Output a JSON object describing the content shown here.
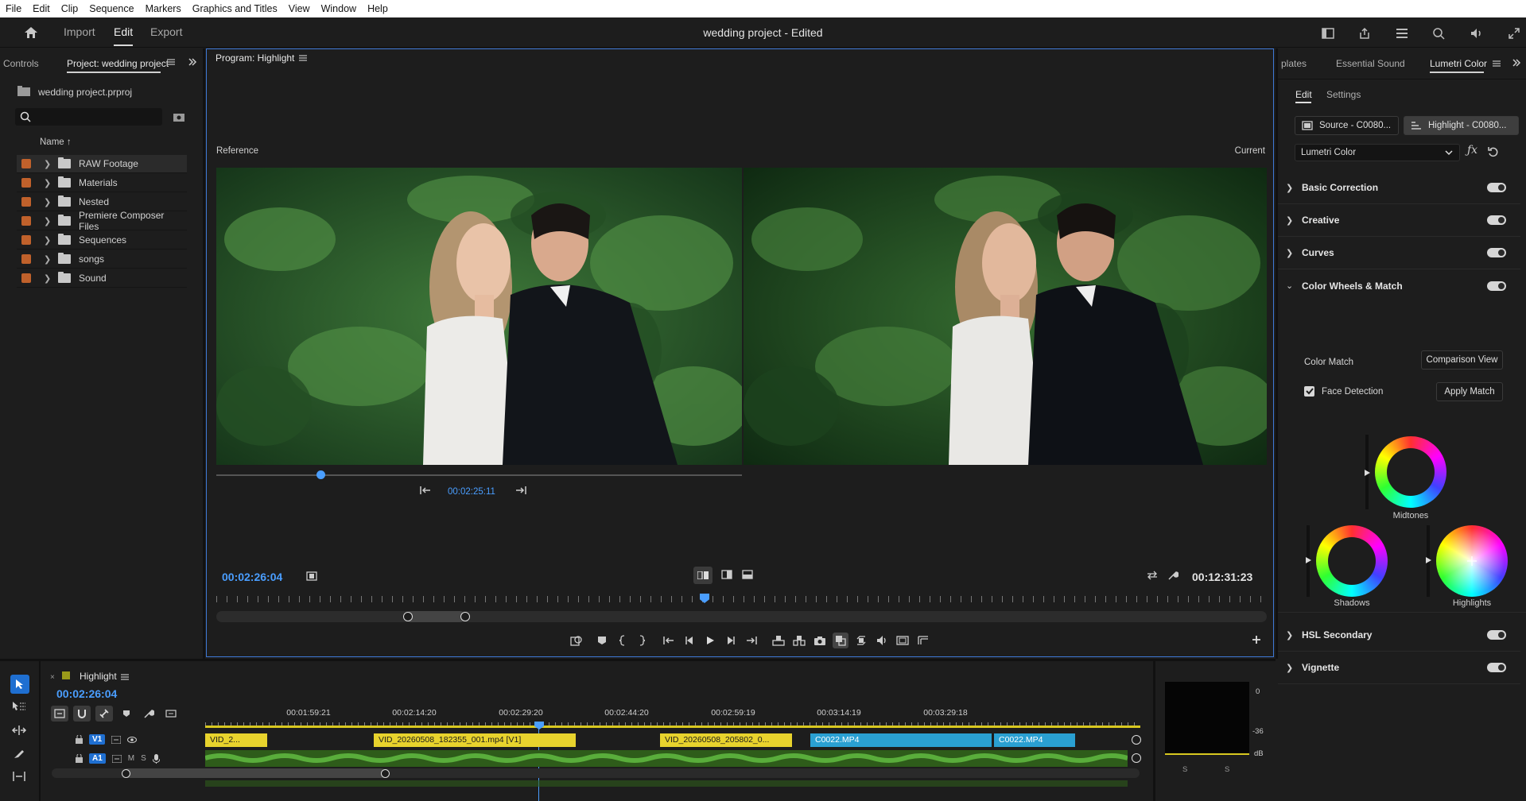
{
  "menu": [
    "File",
    "Edit",
    "Clip",
    "Sequence",
    "Markers",
    "Graphics and Titles",
    "View",
    "Window",
    "Help"
  ],
  "workspaces": {
    "home_icon": "home-icon",
    "import": "Import",
    "edit": "Edit",
    "export": "Export"
  },
  "document_title": "wedding project - Edited",
  "left_panel": {
    "tab_controls": "Controls",
    "tab_project": "Project: wedding project",
    "project_file": "wedding project.prproj",
    "search_placeholder": "",
    "column_name": "Name",
    "folders": [
      "RAW Footage",
      "Materials",
      "Nested",
      "Premiere Composer Files",
      "Sequences",
      "songs",
      "Sound"
    ]
  },
  "program": {
    "title": "Program: Highlight",
    "reference_label": "Reference",
    "current_label": "Current",
    "ref_timecode": "00:02:25:11",
    "playhead_timecode": "00:02:26:04",
    "duration_timecode": "00:12:31:23"
  },
  "lumetri": {
    "tab_templates": "plates",
    "tab_sound": "Essential Sound",
    "tab_lumetri": "Lumetri Color",
    "sub_edit": "Edit",
    "sub_settings": "Settings",
    "source_clip": "Source - C0080...",
    "highlight_clip": "Highlight - C0080...",
    "effect": "Lumetri Color",
    "sections": [
      "Basic Correction",
      "Creative",
      "Curves",
      "Color Wheels & Match"
    ],
    "color_match": "Color Match",
    "comparison_view": "Comparison View",
    "face_detection": "Face Detection",
    "face_detection_checked": true,
    "apply_match": "Apply Match",
    "wheels": {
      "midtones": "Midtones",
      "shadows": "Shadows",
      "highlights": "Highlights"
    },
    "sections_after": [
      "HSL Secondary",
      "Vignette"
    ]
  },
  "timeline": {
    "sequence": "Highlight",
    "timecode": "00:02:26:04",
    "ruler": [
      "00:01:59:21",
      "00:02:14:20",
      "00:02:29:20",
      "00:02:44:20",
      "00:02:59:19",
      "00:03:14:19",
      "00:03:29:18"
    ],
    "v1": "V1",
    "a1": "A1",
    "a1_m": "M",
    "a1_s": "S",
    "clips": [
      "VID_2...",
      "VID_20260508_182355_001.mp4 [V1]",
      "VID_20260508_205802_0...",
      "C0022.MP4",
      "C0022.MP4"
    ]
  },
  "meter": {
    "labels": [
      "0",
      "-36",
      "dB"
    ],
    "solo": [
      "S",
      "S"
    ]
  },
  "colors": {
    "accent": "#4a9eff",
    "video_clip": "#e8d32d",
    "selected_clip": "#2aa0d2",
    "audio": "#2e5c1a",
    "label_orange": "#c0612b"
  }
}
